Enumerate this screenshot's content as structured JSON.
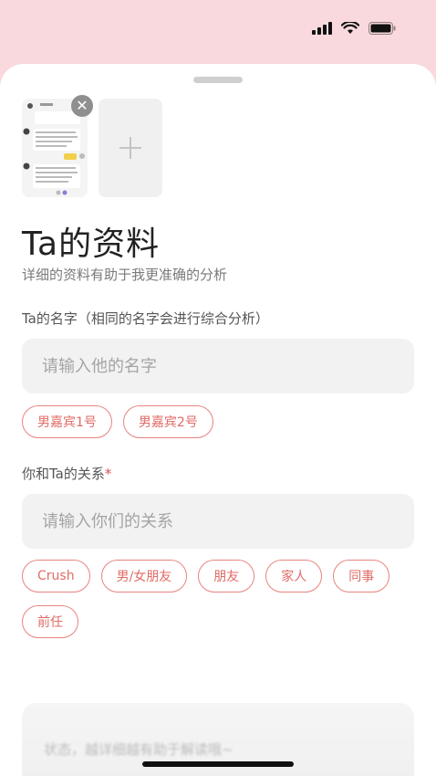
{
  "status_bar": {
    "signal": "cellular-signal-icon",
    "wifi": "wifi-icon",
    "battery": "battery-icon"
  },
  "attachments": {
    "close_symbol": "✕",
    "add_symbol": "+"
  },
  "profile": {
    "title": "Ta的资料",
    "subtitle": "详细的资料有助于我更准确的分析",
    "name_label": "Ta的名字（相同的名字会进行综合分析）",
    "name_placeholder": "请输入他的名字",
    "name_chips": [
      "男嘉宾1号",
      "男嘉宾2号"
    ],
    "relation_label": "你和Ta的关系",
    "required_mark": "*",
    "relation_placeholder": "请输入你们的关系",
    "relation_chips": [
      "Crush",
      "男/女朋友",
      "朋友",
      "家人",
      "同事",
      "前任"
    ],
    "bottom_hint": "状态，越详细越有助于解读哦~"
  },
  "colors": {
    "accent": "#e06b66",
    "background_top": "#f9d9dd"
  }
}
